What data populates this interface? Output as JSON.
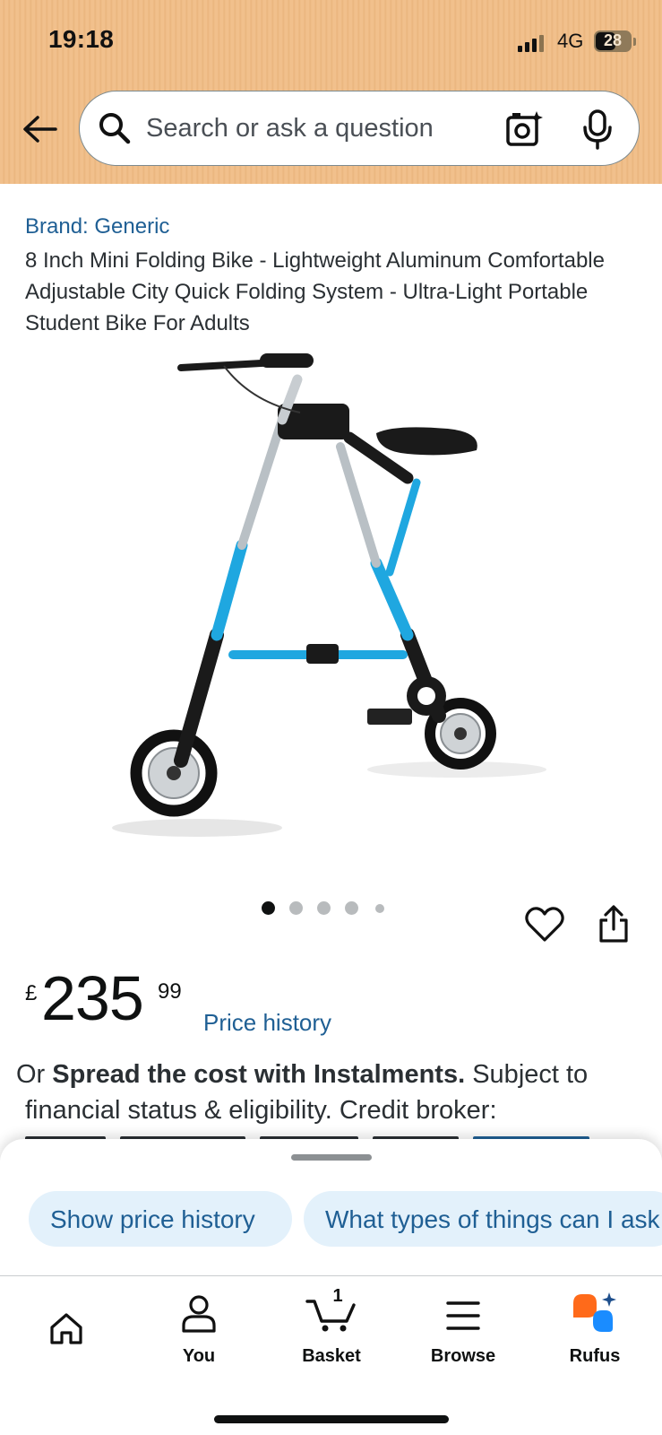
{
  "status_bar": {
    "time": "19:18",
    "network": "4G",
    "battery": "28"
  },
  "header": {
    "back_icon": "arrow-left-icon",
    "search_placeholder": "Search or ask a question",
    "camera_icon": "camera-search-icon",
    "mic_icon": "microphone-icon",
    "background_color": "#f1c08c"
  },
  "product": {
    "brand": "Brand: Generic",
    "title": "8 Inch Mini Folding Bike - Lightweight Aluminum Comfortable Adjustable City Quick Folding System - Ultra-Light Portable Student Bike For Adults",
    "image_icon": "folding-bike-image",
    "image_dots": {
      "count": 5,
      "active_index": 0
    },
    "wishlist_icon": "heart-icon",
    "share_icon": "share-icon",
    "price_currency": "£",
    "price_whole": "235",
    "price_fraction": "99",
    "price_history_link": "Price history",
    "instalments_prefix": "Or ",
    "instalments_bold": "Spread the cost with Instalments.",
    "instalments_suffix": " Subject to",
    "instalments_line2": "financial status & eligibility. Credit broker:"
  },
  "rufus_sheet": {
    "chips": [
      {
        "label": "Show price history"
      },
      {
        "label": "What types of things can I ask"
      }
    ]
  },
  "tabbar": {
    "items": [
      {
        "label": "",
        "icon": "home-icon"
      },
      {
        "label": "You",
        "icon": "person-icon"
      },
      {
        "label": "Basket",
        "icon": "basket-icon",
        "count": "1"
      },
      {
        "label": "Browse",
        "icon": "menu-icon"
      },
      {
        "label": "Rufus",
        "icon": "rufus-icon"
      }
    ]
  },
  "colors": {
    "link": "#1f5f94",
    "chip_bg": "#e3f1fb",
    "rufus_orange": "#ff6a1a",
    "rufus_blue": "#1a8cff"
  }
}
